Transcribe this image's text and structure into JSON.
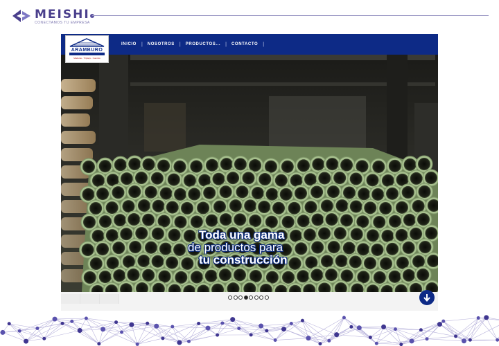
{
  "brand": {
    "name": "MEISHI",
    "tagline": "CONECTAMOS TU EMPRESA",
    "color": "#4a3f8c"
  },
  "site": {
    "logo_text": "ARAMBURO",
    "logo_subtext": "Maderas - Triplays - Cuentos",
    "nav": [
      {
        "label": "INICIO"
      },
      {
        "label": "NOSOTROS"
      },
      {
        "label": "PRODUCTOS..."
      },
      {
        "label": "CONTACTO"
      }
    ],
    "hero": {
      "line1": "Toda una gama",
      "line2": "de productos para",
      "line3": "tu construcción"
    },
    "slider": {
      "dot_count": 8,
      "active_index": 3
    },
    "colors": {
      "navbar": "#0d2a86",
      "pipe": "#a7c08e"
    },
    "icons": {
      "scroll_down": "arrow-down-icon"
    }
  }
}
